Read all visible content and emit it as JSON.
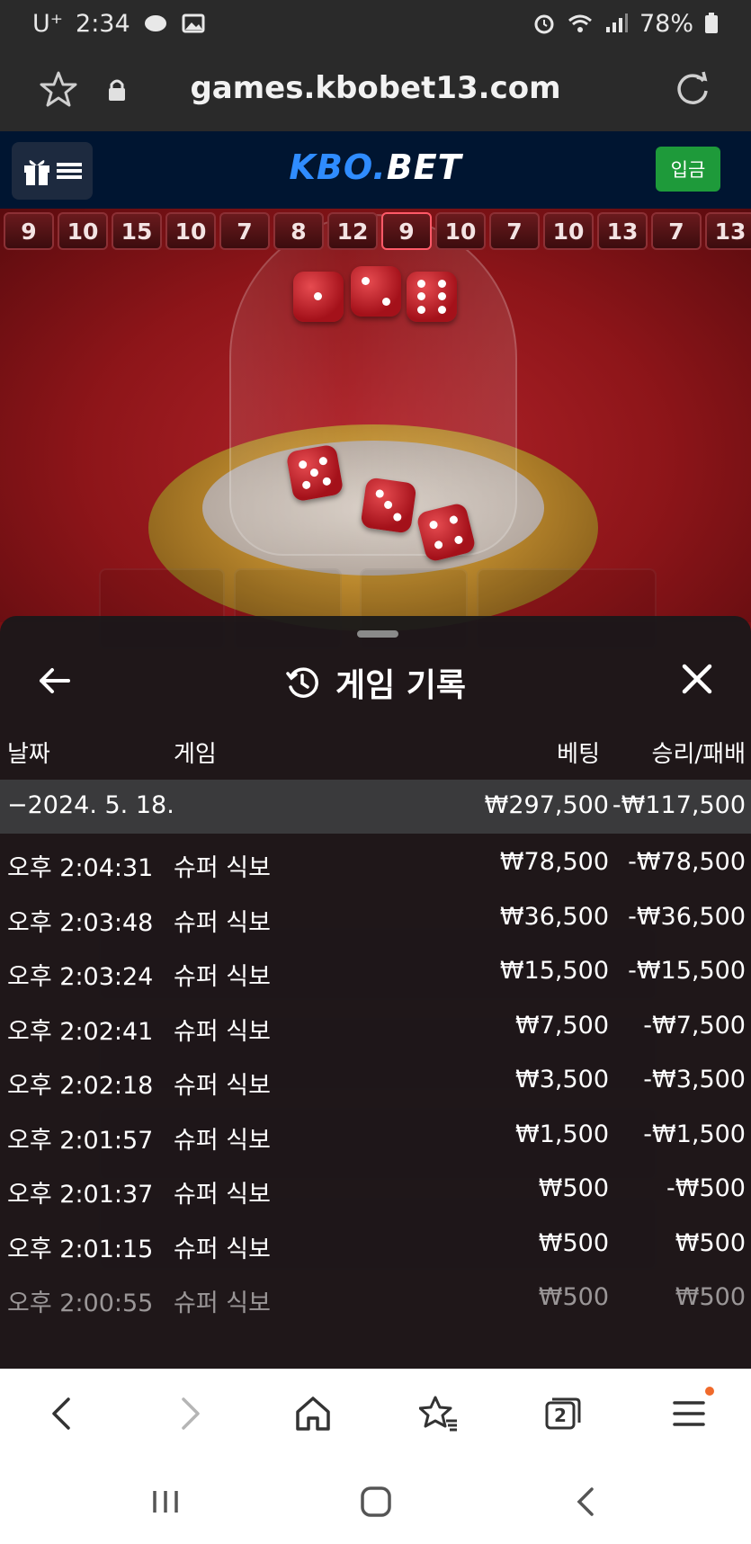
{
  "statusbar": {
    "carrier": "U⁺",
    "time": "2:34",
    "battery": "78%"
  },
  "browser": {
    "url": "games.kbobet13.com"
  },
  "site": {
    "logo_kbo": "KBO.",
    "logo_bet": "BET",
    "deposit_label": "입금"
  },
  "history_strip": [
    "9",
    "10",
    "15",
    "10",
    "7",
    "8",
    "12",
    "9",
    "10",
    "7",
    "10",
    "13",
    "7",
    "13"
  ],
  "panel": {
    "title": "게임 기록",
    "columns": {
      "date": "날짜",
      "game": "게임",
      "bet": "베팅",
      "winloss": "승리/패배"
    },
    "date_row": {
      "date": "−2024. 5. 18.",
      "bet": "₩297,500",
      "winloss": "-₩117,500"
    },
    "rows": [
      {
        "time": "오후 2:04:31",
        "game": "슈퍼 식보",
        "bet": "₩78,500",
        "winloss": "-₩78,500"
      },
      {
        "time": "오후 2:03:48",
        "game": "슈퍼 식보",
        "bet": "₩36,500",
        "winloss": "-₩36,500"
      },
      {
        "time": "오후 2:03:24",
        "game": "슈퍼 식보",
        "bet": "₩15,500",
        "winloss": "-₩15,500"
      },
      {
        "time": "오후 2:02:41",
        "game": "슈퍼 식보",
        "bet": "₩7,500",
        "winloss": "-₩7,500"
      },
      {
        "time": "오후 2:02:18",
        "game": "슈퍼 식보",
        "bet": "₩3,500",
        "winloss": "-₩3,500"
      },
      {
        "time": "오후 2:01:57",
        "game": "슈퍼 식보",
        "bet": "₩1,500",
        "winloss": "-₩1,500"
      },
      {
        "time": "오후 2:01:37",
        "game": "슈퍼 식보",
        "bet": "₩500",
        "winloss": "-₩500"
      },
      {
        "time": "오후 2:01:15",
        "game": "슈퍼 식보",
        "bet": "₩500",
        "winloss": "₩500"
      },
      {
        "time": "오후 2:00:55",
        "game": "슈퍼 식보",
        "bet": "₩500",
        "winloss": "₩500"
      }
    ]
  },
  "colors": {
    "header_bg": "#001531",
    "logo_blue": "#2f8cff",
    "deposit_green": "#1e9a3a",
    "felt_red": "#8d1519",
    "notification_dot": "#f06a2b"
  },
  "icons": [
    "star-icon",
    "lock-icon",
    "reload-icon",
    "gift-icon",
    "menu-icon",
    "history-clock-icon",
    "back-arrow-icon",
    "close-icon",
    "nav-back-icon",
    "nav-forward-icon",
    "home-icon",
    "bookmarks-icon",
    "tabs-icon",
    "hamburger-icon"
  ],
  "browser_nav": {
    "tab_count": "2"
  }
}
